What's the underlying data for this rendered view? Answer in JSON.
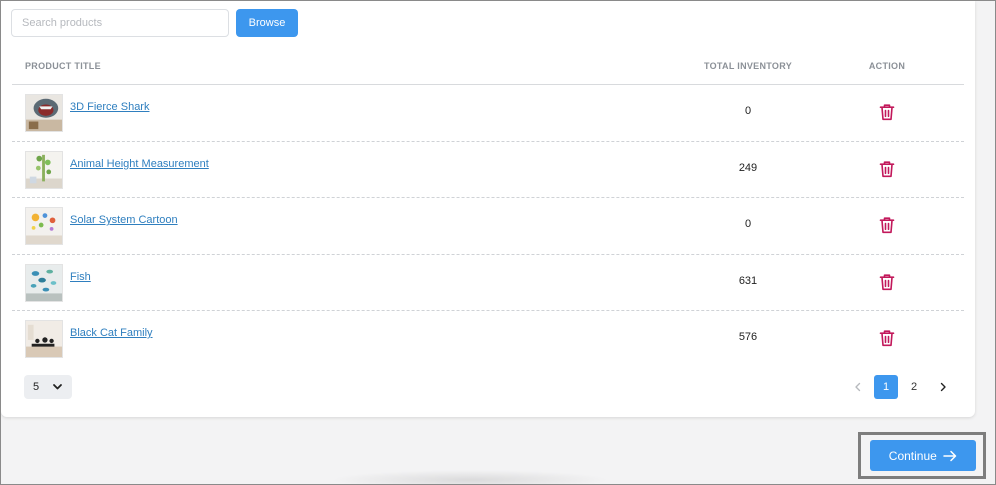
{
  "search": {
    "placeholder": "Search products",
    "value": ""
  },
  "browse_label": "Browse",
  "table": {
    "headers": {
      "title": "PRODUCT TITLE",
      "inventory": "TOTAL INVENTORY",
      "action": "ACTION"
    },
    "rows": [
      {
        "title": "3D Fierce Shark",
        "inventory": "0"
      },
      {
        "title": "Animal Height Measurement",
        "inventory": "249"
      },
      {
        "title": "Solar System Cartoon",
        "inventory": "0"
      },
      {
        "title": "Fish",
        "inventory": "631"
      },
      {
        "title": "Black Cat Family",
        "inventory": "576"
      }
    ]
  },
  "pagination": {
    "page_size": "5",
    "pages": [
      "1",
      "2"
    ],
    "current_page": "1"
  },
  "continue_label": "Continue",
  "colors": {
    "primary": "#3d97ee",
    "link": "#2f7fbf",
    "delete_icon": "#c2185b",
    "header_text": "#8b9097"
  },
  "icons": {
    "delete": "trash-icon",
    "prev": "chevron-left-icon",
    "next": "chevron-right-icon",
    "dropdown": "chevron-down-icon",
    "continue": "arrow-right-icon"
  }
}
